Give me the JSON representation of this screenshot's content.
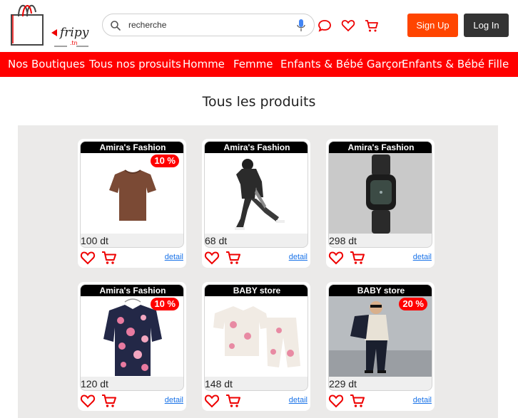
{
  "header": {
    "logo": {
      "text_main": "fripy",
      "text_sub": ".tn"
    },
    "search": {
      "placeholder": "recherche"
    },
    "icons": [
      "search-icon",
      "mic-icon",
      "chat-icon",
      "heart-icon",
      "cart-icon"
    ],
    "signup_label": "Sign Up",
    "login_label": "Log In"
  },
  "nav": {
    "items": [
      {
        "label": "Nos Boutiques"
      },
      {
        "label": "Tous nos prosuits"
      },
      {
        "label": "Homme"
      },
      {
        "label": "Femme"
      },
      {
        "label": "Enfants & Bébé Garçon"
      },
      {
        "label": "Enfants & Bébé Fille"
      }
    ]
  },
  "main": {
    "title": "Tous les produits",
    "products": [
      {
        "shop": "Amira's Fashion",
        "price": "100 dt",
        "discount": "10 %",
        "image": "brown-tshirt",
        "detail": "detail"
      },
      {
        "shop": "Amira's Fashion",
        "price": "68 dt",
        "discount": "",
        "image": "black-tracksuit",
        "detail": "detail"
      },
      {
        "shop": "Amira's Fashion",
        "price": "298 dt",
        "discount": "",
        "image": "black-watch",
        "detail": "detail"
      },
      {
        "shop": "Amira's Fashion",
        "price": "120 dt",
        "discount": "10 %",
        "image": "floral-shirt",
        "detail": "detail"
      },
      {
        "shop": "BABY store",
        "price": "148 dt",
        "discount": "",
        "image": "minnie-pajama",
        "detail": "detail"
      },
      {
        "shop": "BABY store",
        "price": "229 dt",
        "discount": "20 %",
        "image": "boy-suit",
        "detail": "detail"
      }
    ]
  },
  "colors": {
    "brand_red": "#ff0000",
    "signup_orange": "#ff4500",
    "login_dark": "#333333",
    "product_bg": "#ebeae9",
    "link_blue": "#1a73e8"
  }
}
